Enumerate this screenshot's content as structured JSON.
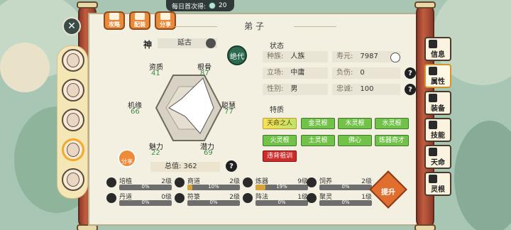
{
  "top": {
    "daily_label": "每日首次得:",
    "daily_value": "20",
    "buttons": [
      "攻略",
      "配装",
      "分享"
    ],
    "title": "弟子"
  },
  "disciple": {
    "tag": "神",
    "name": "延古",
    "seal": "绝代",
    "attributes": [
      {
        "label": "资质",
        "value": "41"
      },
      {
        "label": "根骨",
        "value": "87"
      },
      {
        "label": "聪慧",
        "value": "77"
      },
      {
        "label": "潜力",
        "value": "69"
      },
      {
        "label": "魅力",
        "value": "22"
      },
      {
        "label": "机缘",
        "value": "66"
      }
    ],
    "share_label": "分享",
    "total": "总值: 362"
  },
  "status": {
    "title": "状态",
    "rows": [
      {
        "label": "种族:",
        "value": "人族"
      },
      {
        "label": "寿元:",
        "value": "7987"
      },
      {
        "label": "立场:",
        "value": "中庸"
      },
      {
        "label": "负伤:",
        "value": "0"
      },
      {
        "label": "性别:",
        "value": "男"
      },
      {
        "label": "忠诚:",
        "value": "100"
      }
    ]
  },
  "traits": {
    "title": "特质",
    "items": [
      "天命之人",
      "金灵根",
      "木灵根",
      "水灵根",
      "火灵根",
      "土灵根",
      "佛心",
      "炼器奇才",
      "违背祖训"
    ]
  },
  "skills": [
    {
      "name": "培植",
      "level": "2级",
      "pct": "0%"
    },
    {
      "name": "商道",
      "level": "2级",
      "pct": "10%"
    },
    {
      "name": "炼器",
      "level": "9级",
      "pct": "19%"
    },
    {
      "name": "饲养",
      "level": "2级",
      "pct": "0%"
    },
    {
      "name": "丹道",
      "level": "0级",
      "pct": "0%"
    },
    {
      "name": "符箓",
      "level": "2级",
      "pct": "0%"
    },
    {
      "name": "阵法",
      "level": "1级",
      "pct": "0%"
    },
    {
      "name": "聚灵",
      "level": "1级",
      "pct": "0%"
    }
  ],
  "upgrade_label": "提升",
  "tabs": [
    "信息",
    "属性",
    "装备",
    "技能",
    "天命",
    "灵根"
  ]
}
